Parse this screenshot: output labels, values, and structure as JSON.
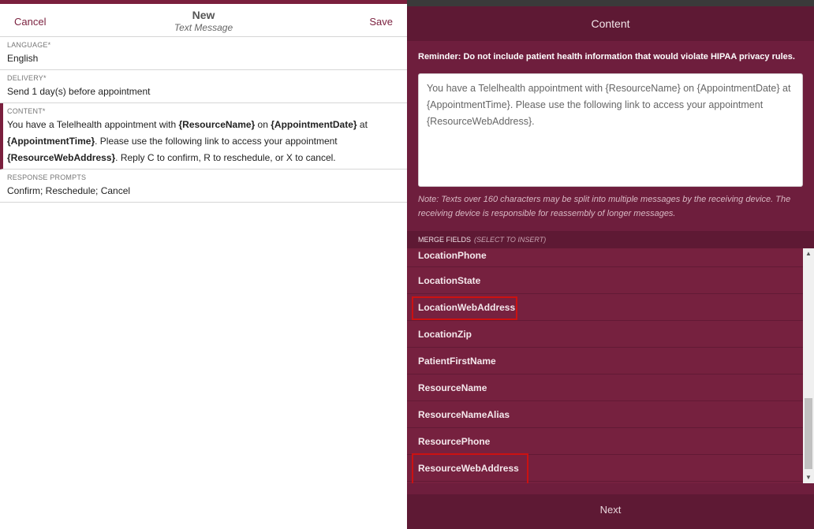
{
  "header": {
    "cancel_label": "Cancel",
    "title": "New",
    "subtitle": "Text Message",
    "save_label": "Save"
  },
  "fields": {
    "language": {
      "label": "LANGUAGE*",
      "value": "English"
    },
    "delivery": {
      "label": "DELIVERY*",
      "value": "Send 1 day(s) before appointment"
    },
    "content": {
      "label": "CONTENT*",
      "parts": [
        "You have a Telelhealth appointment with ",
        "{ResourceName}",
        " on ",
        "{AppointmentDate}",
        " at ",
        "{AppointmentTime}",
        ". Please use the following link to access your appointment ",
        "{ResourceWebAddress}",
        ". Reply C to confirm, R to reschedule, or X to cancel."
      ]
    },
    "response_prompts": {
      "label": "RESPONSE PROMPTS",
      "value": "Confirm; Reschedule; Cancel"
    }
  },
  "panel": {
    "title": "Content",
    "reminder": "Reminder: Do not include patient health information that would violate HIPAA privacy rules.",
    "content_text": "You have a Telelhealth appointment with {ResourceName} on {AppointmentDate} at {AppointmentTime}. Please use the following link to access your appointment {ResourceWebAddress}.",
    "note": "Note: Texts over 160 characters may be split into multiple messages by the receiving device. The receiving device is responsible for reassembly of longer messages.",
    "merge_fields_label": "MERGE FIELDS",
    "merge_fields_hint": "(SELECT TO INSERT)",
    "merge_fields": [
      "LocationPhone",
      "LocationState",
      "LocationWebAddress",
      "LocationZip",
      "PatientFirstName",
      "ResourceName",
      "ResourceNameAlias",
      "ResourcePhone",
      "ResourceWebAddress"
    ],
    "next_label": "Next"
  },
  "colors": {
    "brand": "#7a1f3d",
    "panel_bg": "#6e1e3d",
    "highlight": "#cc1111"
  }
}
